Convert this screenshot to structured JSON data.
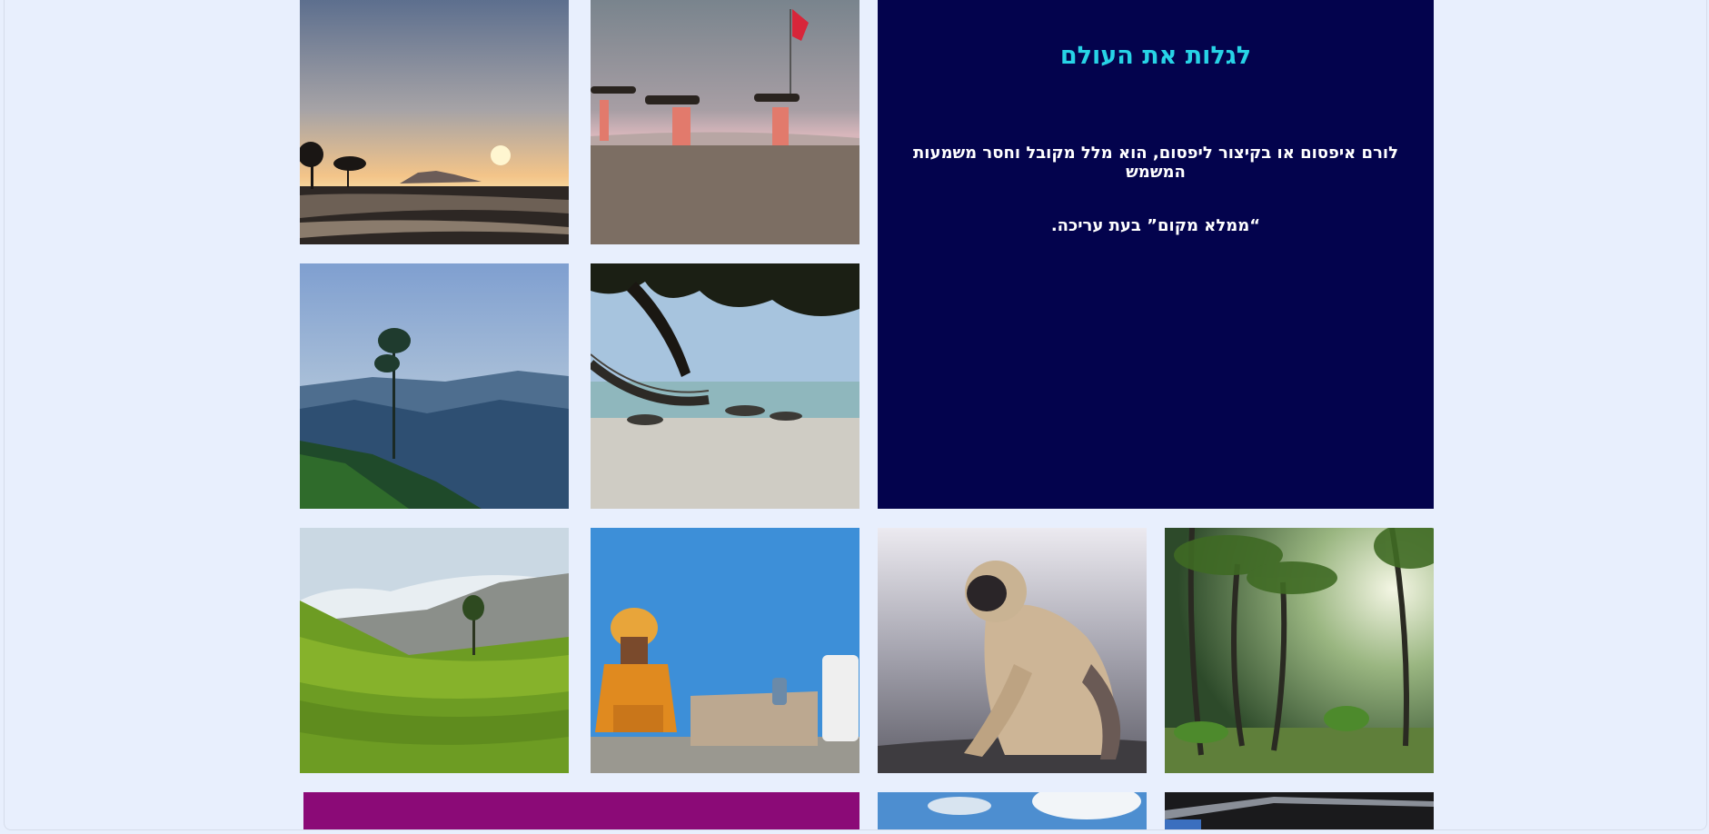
{
  "feature": {
    "heading": "לגלות את העולם",
    "line1": "לורם איפסום או בקיצור ליפסום, הוא מלל מקובל וחסר משמעות המשמש",
    "line2": "“ממלא מקום” בעת עריכה."
  },
  "colors": {
    "feature_background": "#03034d",
    "heading_color": "#27d3e6",
    "page_background": "#e8effd",
    "purple_block": "#8b0a77"
  },
  "gallery": [
    {
      "name": "sunset-photo",
      "subject": "sunset over mudflats"
    },
    {
      "name": "beach-carriers-photo",
      "subject": "women carrying wood on beach with red flag"
    },
    {
      "name": "misty-hills-photo",
      "subject": "misty blue hills with tall tree"
    },
    {
      "name": "hammock-beach-photo",
      "subject": "hammock under tree on beach"
    },
    {
      "name": "tea-plantation-photo",
      "subject": "green tea plantation hills"
    },
    {
      "name": "sadhu-photo",
      "subject": "man in orange sitting against blue wall"
    },
    {
      "name": "langur-photo",
      "subject": "grey langur monkey on rock"
    },
    {
      "name": "palm-forest-photo",
      "subject": "sunlit palm forest"
    },
    {
      "name": "sky-photo",
      "subject": "blue sky with clouds"
    },
    {
      "name": "dark-photo",
      "subject": "dark interior"
    }
  ]
}
